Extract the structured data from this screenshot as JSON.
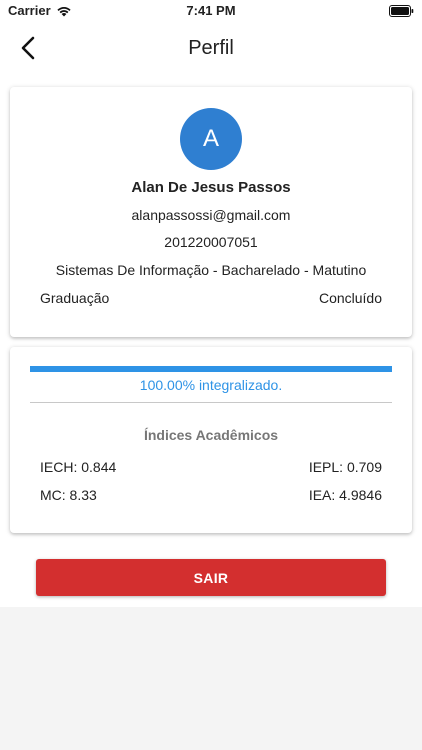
{
  "status_bar": {
    "carrier": "Carrier",
    "time": "7:41 PM"
  },
  "nav": {
    "title": "Perfil"
  },
  "profile": {
    "avatar_initial": "A",
    "name": "Alan De Jesus Passos",
    "email": "alanpassossi@gmail.com",
    "registration": "201220007051",
    "course": "Sistemas De Informação - Bacharelado - Matutino",
    "level": "Graduação",
    "status": "Concluído"
  },
  "progress": {
    "percent": 100,
    "label": "100.00% integralizado."
  },
  "indices": {
    "title": "Índices Acadêmicos",
    "iech": "IECH: 0.844",
    "iepl": "IEPL: 0.709",
    "mc": "MC: 8.33",
    "iea": "IEA: 4.9846"
  },
  "actions": {
    "logout_label": "SAIR"
  },
  "colors": {
    "accent": "#2e93e6",
    "avatar": "#2f7fd1",
    "danger": "#d32f2f"
  }
}
